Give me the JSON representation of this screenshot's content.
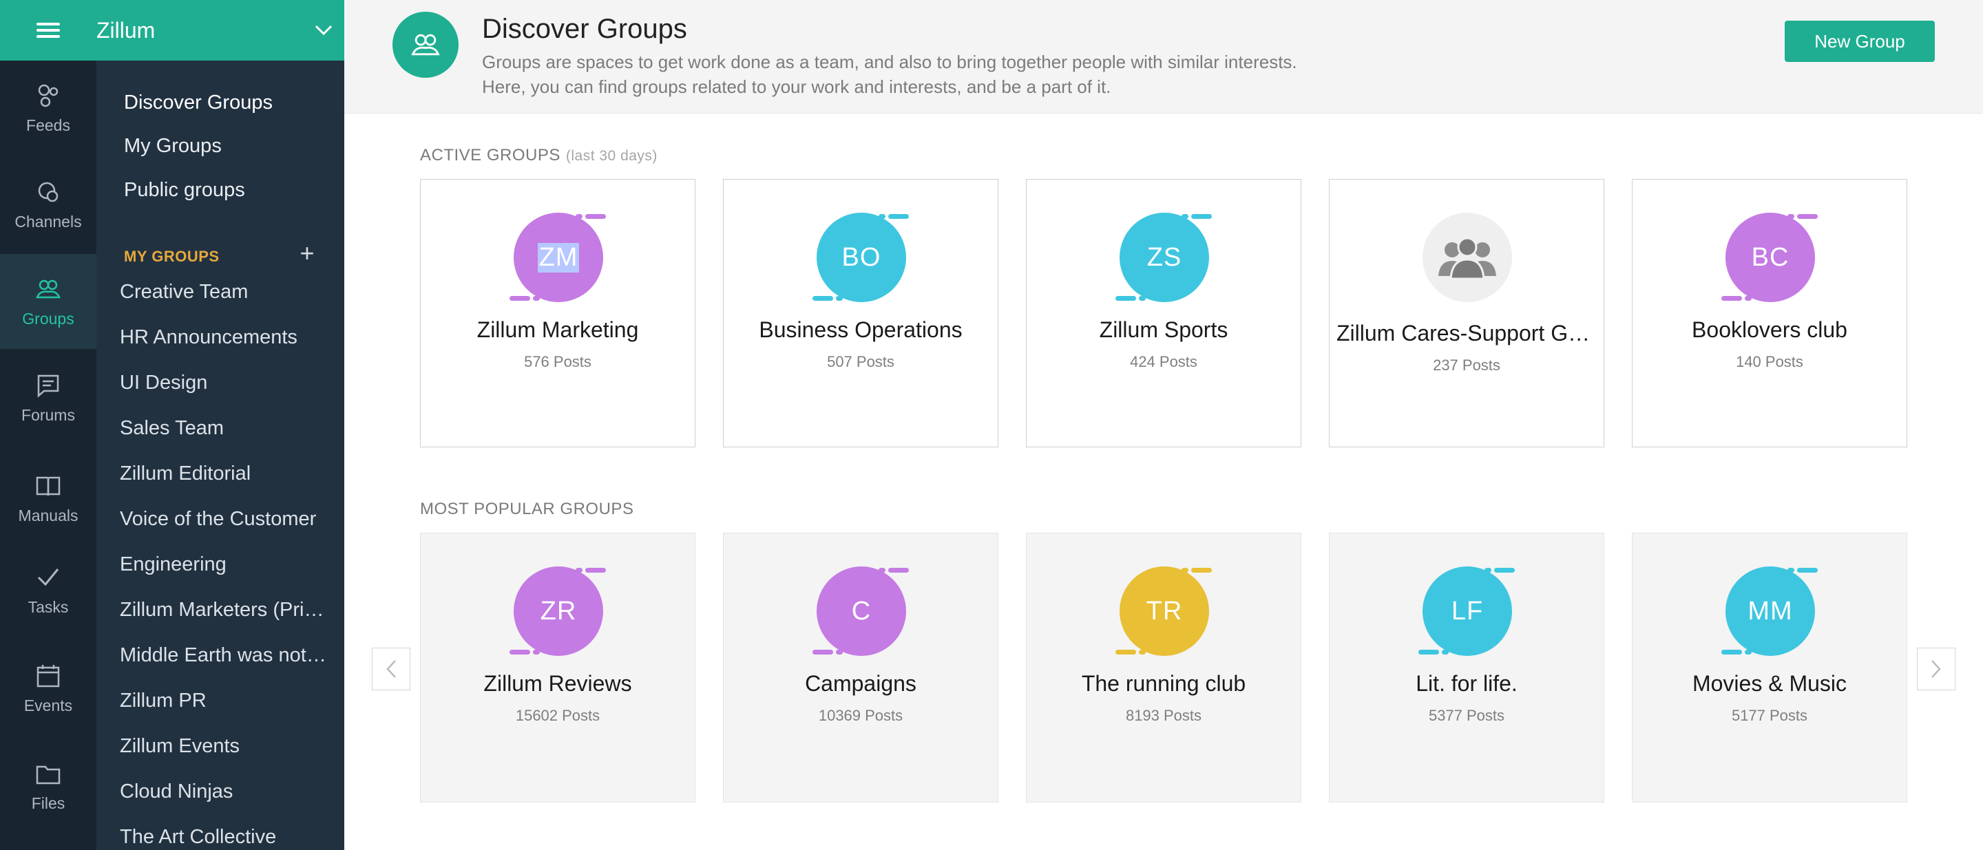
{
  "org": {
    "name": "Zillum"
  },
  "rail": [
    {
      "label": "Feeds",
      "icon": "feeds-icon"
    },
    {
      "label": "Channels",
      "icon": "channels-icon"
    },
    {
      "label": "Groups",
      "icon": "groups-icon",
      "active": true
    },
    {
      "label": "Forums",
      "icon": "forums-icon"
    },
    {
      "label": "Manuals",
      "icon": "manuals-icon"
    },
    {
      "label": "Tasks",
      "icon": "tasks-icon"
    },
    {
      "label": "Events",
      "icon": "events-icon"
    },
    {
      "label": "Files",
      "icon": "files-icon"
    }
  ],
  "sidebar": {
    "links": [
      "Discover Groups",
      "My Groups",
      "Public groups"
    ],
    "my_groups_heading": "MY GROUPS",
    "groups": [
      "Creative Team",
      "HR Announcements",
      "UI Design",
      "Sales Team",
      "Zillum Editorial",
      "Voice of the Customer",
      "Engineering",
      "Zillum Marketers (Private)",
      "Middle Earth was not built in a day",
      "Zillum PR",
      "Zillum Events",
      "Cloud Ninjas",
      "The Art Collective"
    ]
  },
  "header": {
    "title": "Discover Groups",
    "desc_line1": "Groups are spaces to get work done as a team, and also to bring together people with similar interests.",
    "desc_line2": "Here, you can find groups related to your work and interests, and be a part of it.",
    "new_button": "New Group"
  },
  "active": {
    "title": "ACTIVE GROUPS",
    "subtitle": "(last 30 days)",
    "cards": [
      {
        "initials": "ZM",
        "name": "Zillum Marketing",
        "posts": "576 Posts",
        "color": "#c47be3"
      },
      {
        "initials": "BO",
        "name": "Business Operations",
        "posts": "507 Posts",
        "color": "#3ec6e0"
      },
      {
        "initials": "ZS",
        "name": "Zillum Sports",
        "posts": "424 Posts",
        "color": "#3ec6e0"
      },
      {
        "initials": "",
        "name": "Zillum Cares-Support Group",
        "posts": "237 Posts",
        "color": "#efefef"
      },
      {
        "initials": "BC",
        "name": "Booklovers club",
        "posts": "140 Posts",
        "color": "#c47be3"
      }
    ]
  },
  "popular": {
    "title": "MOST POPULAR GROUPS",
    "cards": [
      {
        "initials": "ZR",
        "name": "Zillum Reviews",
        "posts": "15602 Posts",
        "color": "#c47be3"
      },
      {
        "initials": "C",
        "name": "Campaigns",
        "posts": "10369 Posts",
        "color": "#c47be3"
      },
      {
        "initials": "TR",
        "name": "The running club",
        "posts": "8193 Posts",
        "color": "#e8bf35"
      },
      {
        "initials": "LF",
        "name": "Lit. for life.",
        "posts": "5377 Posts",
        "color": "#3ec6e0"
      },
      {
        "initials": "MM",
        "name": "Movies & Music",
        "posts": "5177 Posts",
        "color": "#3ec6e0"
      }
    ]
  }
}
